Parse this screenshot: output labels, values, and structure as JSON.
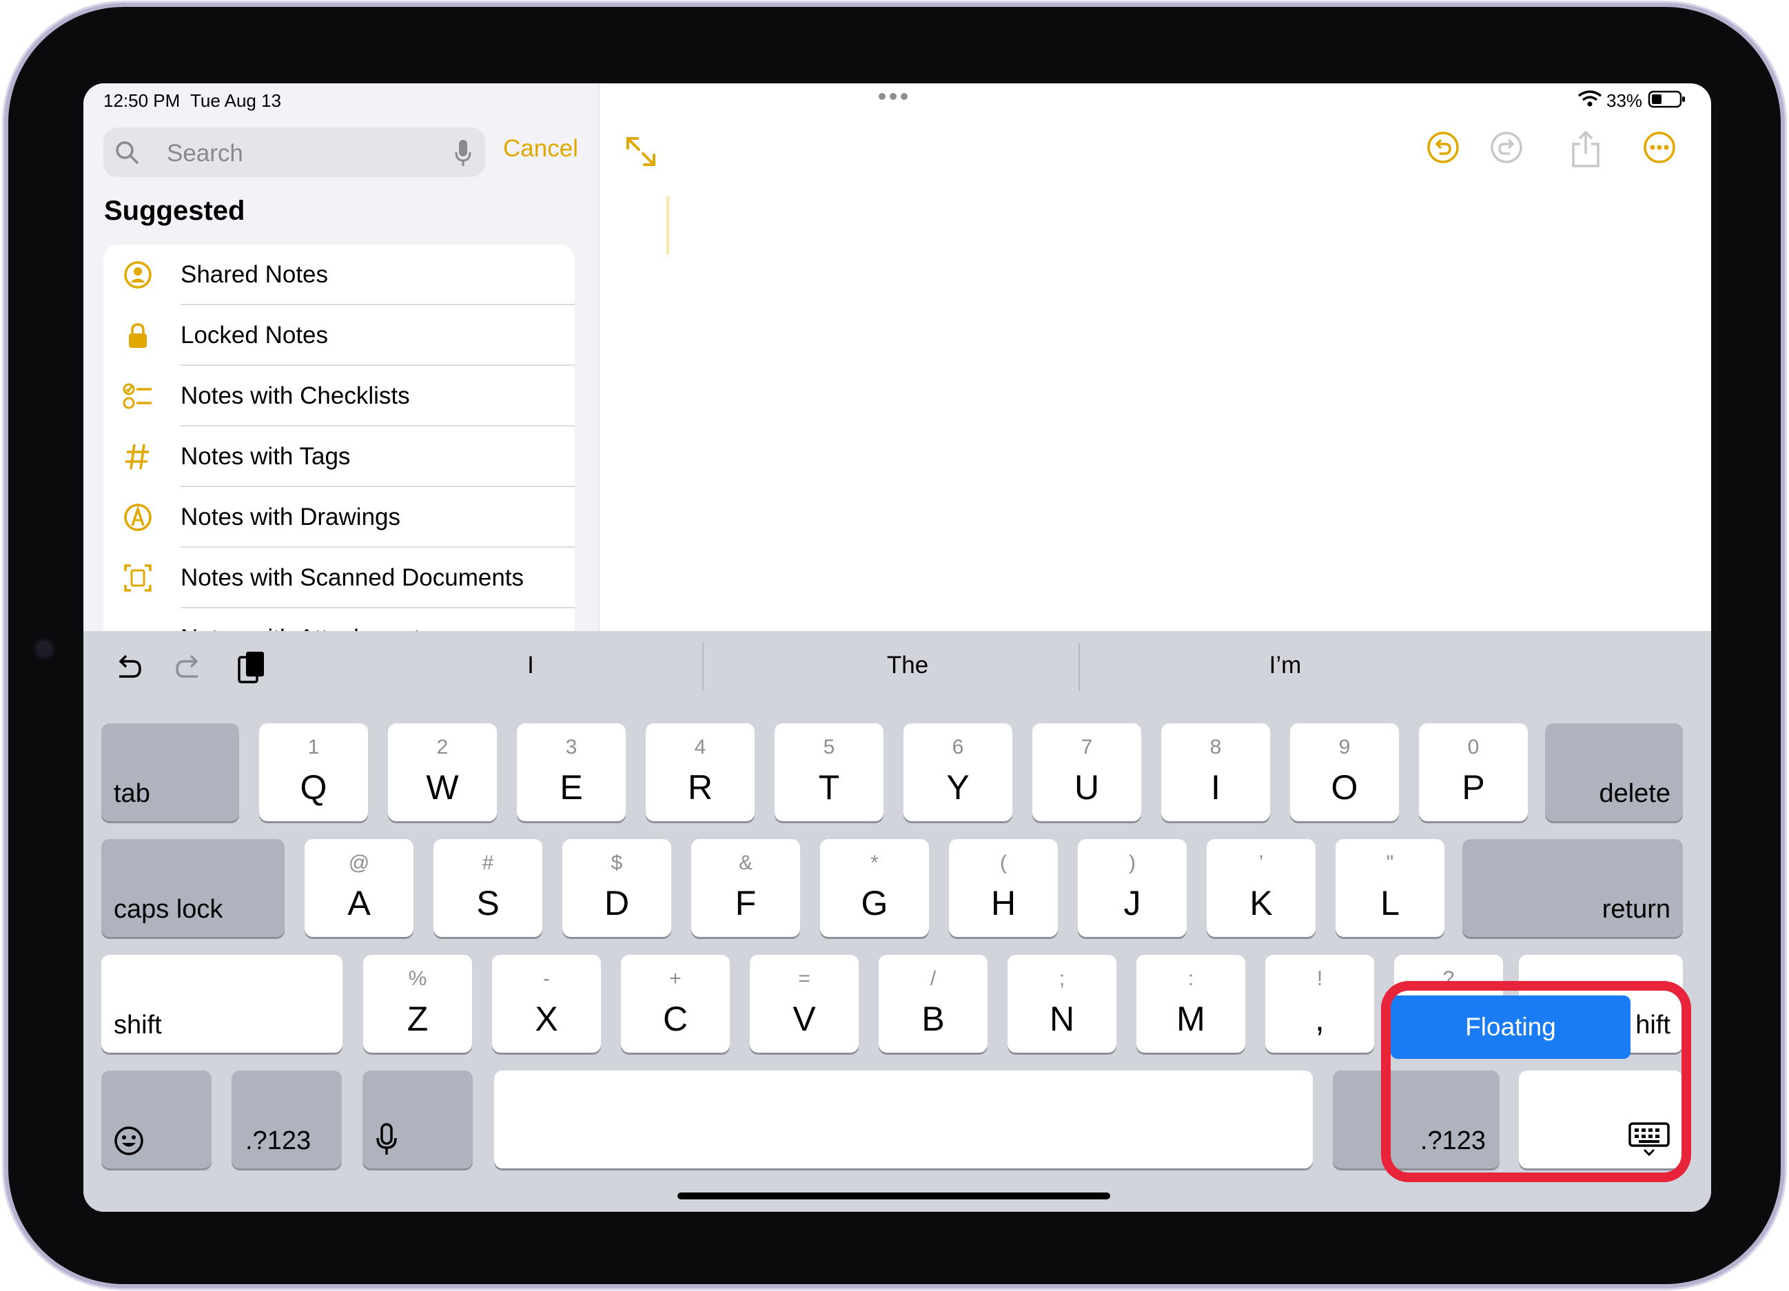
{
  "status": {
    "time": "12:50 PM",
    "date": "Tue Aug 13",
    "battery": "33%"
  },
  "sidebar": {
    "search_placeholder": "Search",
    "cancel_label": "Cancel",
    "section_title": "Suggested",
    "items": [
      {
        "label": "Shared Notes",
        "icon": "person-circle-icon"
      },
      {
        "label": "Locked Notes",
        "icon": "lock-icon"
      },
      {
        "label": "Notes with Checklists",
        "icon": "checklist-icon"
      },
      {
        "label": "Notes with Tags",
        "icon": "hashtag-icon"
      },
      {
        "label": "Notes with Drawings",
        "icon": "pencil-tip-circle-icon"
      },
      {
        "label": "Notes with Scanned Documents",
        "icon": "doc-scan-icon"
      },
      {
        "label": "Notes with Attachments",
        "icon": "paperclip-icon"
      }
    ]
  },
  "editor": {
    "accent": "#e0a800"
  },
  "keyboard": {
    "predictions": [
      "I",
      "The",
      "I’m"
    ],
    "row1": [
      {
        "sec": "1",
        "main": "Q"
      },
      {
        "sec": "2",
        "main": "W"
      },
      {
        "sec": "3",
        "main": "E"
      },
      {
        "sec": "4",
        "main": "R"
      },
      {
        "sec": "5",
        "main": "T"
      },
      {
        "sec": "6",
        "main": "Y"
      },
      {
        "sec": "7",
        "main": "U"
      },
      {
        "sec": "8",
        "main": "I"
      },
      {
        "sec": "9",
        "main": "O"
      },
      {
        "sec": "0",
        "main": "P"
      }
    ],
    "row2": [
      {
        "sec": "@",
        "main": "A"
      },
      {
        "sec": "#",
        "main": "S"
      },
      {
        "sec": "$",
        "main": "D"
      },
      {
        "sec": "&",
        "main": "F"
      },
      {
        "sec": "*",
        "main": "G"
      },
      {
        "sec": "(",
        "main": "H"
      },
      {
        "sec": ")",
        "main": "J"
      },
      {
        "sec": "’",
        "main": "K"
      },
      {
        "sec": "\"",
        "main": "L"
      }
    ],
    "row3": [
      {
        "sec": "%",
        "main": "Z"
      },
      {
        "sec": "-",
        "main": "X"
      },
      {
        "sec": "+",
        "main": "C"
      },
      {
        "sec": "=",
        "main": "V"
      },
      {
        "sec": "/",
        "main": "B"
      },
      {
        "sec": ";",
        "main": "N"
      },
      {
        "sec": ":",
        "main": "M"
      },
      {
        "sec": "!",
        "main": ","
      },
      {
        "sec": "?",
        "main": "."
      }
    ],
    "tab": "tab",
    "delete": "delete",
    "caps_lock": "caps lock",
    "return": "return",
    "shift": "shift",
    "shift_right_partial": "hift",
    "num_left": ".?123",
    "num_right": ".?123",
    "floating_label": "Floating",
    "highlight_color": "#e8243a"
  }
}
